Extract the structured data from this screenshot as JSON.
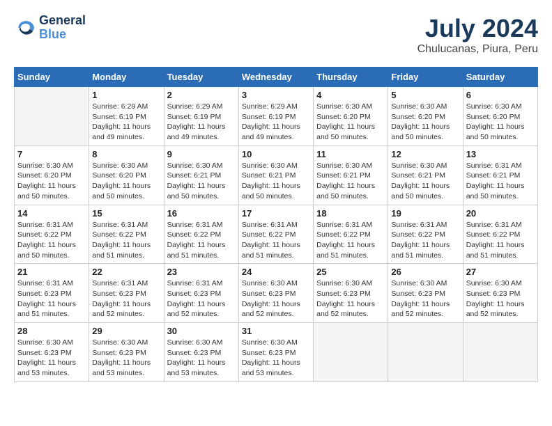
{
  "header": {
    "logo_line1": "General",
    "logo_line2": "Blue",
    "month_year": "July 2024",
    "location": "Chulucanas, Piura, Peru"
  },
  "days_of_week": [
    "Sunday",
    "Monday",
    "Tuesday",
    "Wednesday",
    "Thursday",
    "Friday",
    "Saturday"
  ],
  "weeks": [
    [
      {
        "day": "",
        "empty": true
      },
      {
        "day": "1",
        "sunrise": "Sunrise: 6:29 AM",
        "sunset": "Sunset: 6:19 PM",
        "daylight": "Daylight: 11 hours and 49 minutes."
      },
      {
        "day": "2",
        "sunrise": "Sunrise: 6:29 AM",
        "sunset": "Sunset: 6:19 PM",
        "daylight": "Daylight: 11 hours and 49 minutes."
      },
      {
        "day": "3",
        "sunrise": "Sunrise: 6:29 AM",
        "sunset": "Sunset: 6:19 PM",
        "daylight": "Daylight: 11 hours and 49 minutes."
      },
      {
        "day": "4",
        "sunrise": "Sunrise: 6:30 AM",
        "sunset": "Sunset: 6:20 PM",
        "daylight": "Daylight: 11 hours and 50 minutes."
      },
      {
        "day": "5",
        "sunrise": "Sunrise: 6:30 AM",
        "sunset": "Sunset: 6:20 PM",
        "daylight": "Daylight: 11 hours and 50 minutes."
      },
      {
        "day": "6",
        "sunrise": "Sunrise: 6:30 AM",
        "sunset": "Sunset: 6:20 PM",
        "daylight": "Daylight: 11 hours and 50 minutes."
      }
    ],
    [
      {
        "day": "7",
        "sunrise": "Sunrise: 6:30 AM",
        "sunset": "Sunset: 6:20 PM",
        "daylight": "Daylight: 11 hours and 50 minutes."
      },
      {
        "day": "8",
        "sunrise": "Sunrise: 6:30 AM",
        "sunset": "Sunset: 6:20 PM",
        "daylight": "Daylight: 11 hours and 50 minutes."
      },
      {
        "day": "9",
        "sunrise": "Sunrise: 6:30 AM",
        "sunset": "Sunset: 6:21 PM",
        "daylight": "Daylight: 11 hours and 50 minutes."
      },
      {
        "day": "10",
        "sunrise": "Sunrise: 6:30 AM",
        "sunset": "Sunset: 6:21 PM",
        "daylight": "Daylight: 11 hours and 50 minutes."
      },
      {
        "day": "11",
        "sunrise": "Sunrise: 6:30 AM",
        "sunset": "Sunset: 6:21 PM",
        "daylight": "Daylight: 11 hours and 50 minutes."
      },
      {
        "day": "12",
        "sunrise": "Sunrise: 6:30 AM",
        "sunset": "Sunset: 6:21 PM",
        "daylight": "Daylight: 11 hours and 50 minutes."
      },
      {
        "day": "13",
        "sunrise": "Sunrise: 6:31 AM",
        "sunset": "Sunset: 6:21 PM",
        "daylight": "Daylight: 11 hours and 50 minutes."
      }
    ],
    [
      {
        "day": "14",
        "sunrise": "Sunrise: 6:31 AM",
        "sunset": "Sunset: 6:22 PM",
        "daylight": "Daylight: 11 hours and 50 minutes."
      },
      {
        "day": "15",
        "sunrise": "Sunrise: 6:31 AM",
        "sunset": "Sunset: 6:22 PM",
        "daylight": "Daylight: 11 hours and 51 minutes."
      },
      {
        "day": "16",
        "sunrise": "Sunrise: 6:31 AM",
        "sunset": "Sunset: 6:22 PM",
        "daylight": "Daylight: 11 hours and 51 minutes."
      },
      {
        "day": "17",
        "sunrise": "Sunrise: 6:31 AM",
        "sunset": "Sunset: 6:22 PM",
        "daylight": "Daylight: 11 hours and 51 minutes."
      },
      {
        "day": "18",
        "sunrise": "Sunrise: 6:31 AM",
        "sunset": "Sunset: 6:22 PM",
        "daylight": "Daylight: 11 hours and 51 minutes."
      },
      {
        "day": "19",
        "sunrise": "Sunrise: 6:31 AM",
        "sunset": "Sunset: 6:22 PM",
        "daylight": "Daylight: 11 hours and 51 minutes."
      },
      {
        "day": "20",
        "sunrise": "Sunrise: 6:31 AM",
        "sunset": "Sunset: 6:22 PM",
        "daylight": "Daylight: 11 hours and 51 minutes."
      }
    ],
    [
      {
        "day": "21",
        "sunrise": "Sunrise: 6:31 AM",
        "sunset": "Sunset: 6:23 PM",
        "daylight": "Daylight: 11 hours and 51 minutes."
      },
      {
        "day": "22",
        "sunrise": "Sunrise: 6:31 AM",
        "sunset": "Sunset: 6:23 PM",
        "daylight": "Daylight: 11 hours and 52 minutes."
      },
      {
        "day": "23",
        "sunrise": "Sunrise: 6:31 AM",
        "sunset": "Sunset: 6:23 PM",
        "daylight": "Daylight: 11 hours and 52 minutes."
      },
      {
        "day": "24",
        "sunrise": "Sunrise: 6:30 AM",
        "sunset": "Sunset: 6:23 PM",
        "daylight": "Daylight: 11 hours and 52 minutes."
      },
      {
        "day": "25",
        "sunrise": "Sunrise: 6:30 AM",
        "sunset": "Sunset: 6:23 PM",
        "daylight": "Daylight: 11 hours and 52 minutes."
      },
      {
        "day": "26",
        "sunrise": "Sunrise: 6:30 AM",
        "sunset": "Sunset: 6:23 PM",
        "daylight": "Daylight: 11 hours and 52 minutes."
      },
      {
        "day": "27",
        "sunrise": "Sunrise: 6:30 AM",
        "sunset": "Sunset: 6:23 PM",
        "daylight": "Daylight: 11 hours and 52 minutes."
      }
    ],
    [
      {
        "day": "28",
        "sunrise": "Sunrise: 6:30 AM",
        "sunset": "Sunset: 6:23 PM",
        "daylight": "Daylight: 11 hours and 53 minutes."
      },
      {
        "day": "29",
        "sunrise": "Sunrise: 6:30 AM",
        "sunset": "Sunset: 6:23 PM",
        "daylight": "Daylight: 11 hours and 53 minutes."
      },
      {
        "day": "30",
        "sunrise": "Sunrise: 6:30 AM",
        "sunset": "Sunset: 6:23 PM",
        "daylight": "Daylight: 11 hours and 53 minutes."
      },
      {
        "day": "31",
        "sunrise": "Sunrise: 6:30 AM",
        "sunset": "Sunset: 6:23 PM",
        "daylight": "Daylight: 11 hours and 53 minutes."
      },
      {
        "day": "",
        "empty": true
      },
      {
        "day": "",
        "empty": true
      },
      {
        "day": "",
        "empty": true
      }
    ]
  ]
}
